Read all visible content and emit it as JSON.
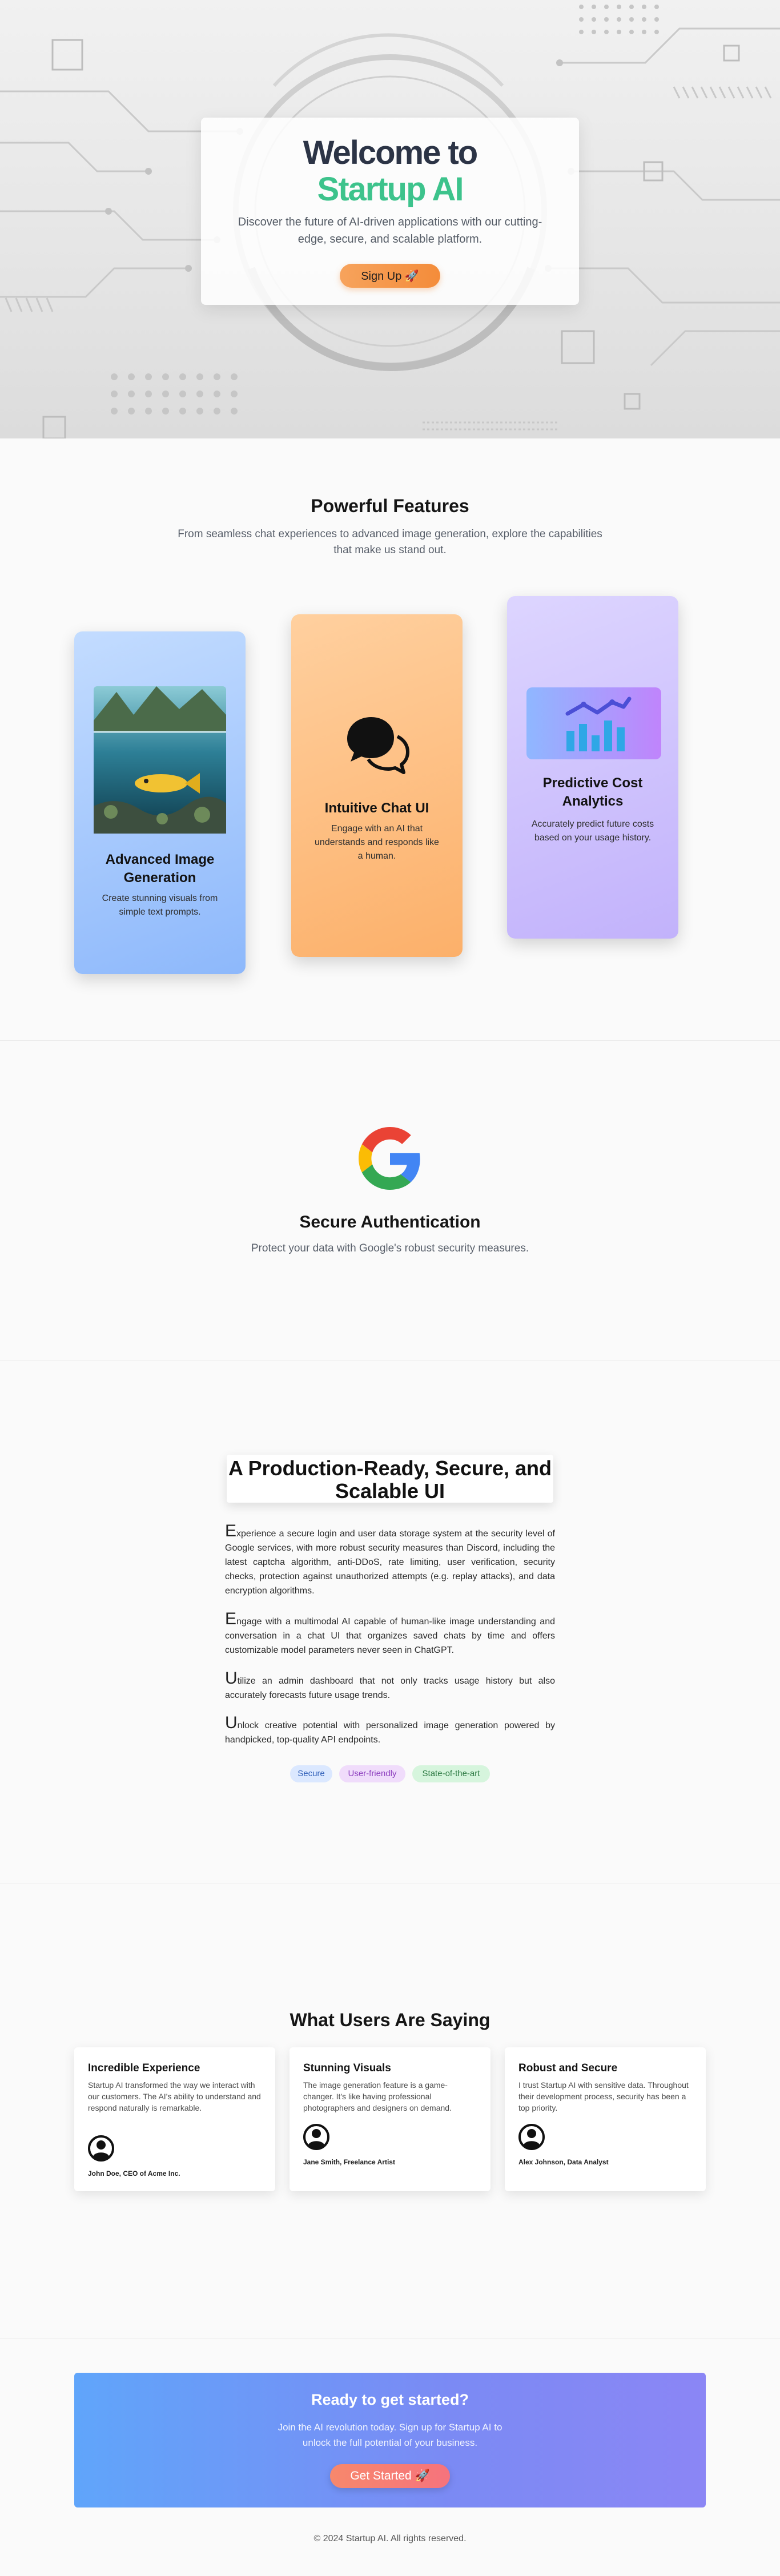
{
  "hero": {
    "title_line1": "Welcome to",
    "title_line2": "Startup AI",
    "subtitle": "Discover the future of AI-driven applications with our cutting-edge, secure, and scalable platform.",
    "cta_label": "Sign Up 🚀"
  },
  "features": {
    "title": "Powerful Features",
    "subtitle": "From seamless chat experiences to advanced image generation, explore the capabilities that make us stand out.",
    "cards": [
      {
        "title": "Advanced Image Generation",
        "desc": "Create stunning visuals from simple text prompts.",
        "icon": "image-icon"
      },
      {
        "title": "Intuitive Chat UI",
        "desc": "Engage with an AI that understands and responds like a human.",
        "icon": "chat-bubbles-icon"
      },
      {
        "title": "Predictive Cost Analytics",
        "desc": "Accurately predict future costs based on your usage history.",
        "icon": "analytics-chart-icon"
      }
    ]
  },
  "auth": {
    "title": "Secure Authentication",
    "subtitle": "Protect your data with Google's robust security measures.",
    "icon": "google-g-icon"
  },
  "production": {
    "title": "A Production-Ready, Secure, and Scalable UI",
    "paragraphs": [
      {
        "cap": "E",
        "text": "xperience a secure login and user data storage system at the security level of Google services, with more robust security measures than Discord, including the latest captcha algorithm, anti-DDoS, rate limiting, user verification, security checks, protection against unauthorized attempts (e.g. replay attacks), and data encryption algorithms."
      },
      {
        "cap": "E",
        "text": "ngage with a multimodal AI capable of human-like image understanding and conversation in a chat UI that organizes saved chats by time and offers customizable model parameters never seen in ChatGPT."
      },
      {
        "cap": "U",
        "text": "tilize an admin dashboard that not only tracks usage history but also accurately forecasts future usage trends."
      },
      {
        "cap": "U",
        "text": "nlock creative potential with personalized image generation powered by handpicked, top-quality API endpoints."
      }
    ],
    "tags": [
      "Secure",
      "User-friendly",
      "State-of-the-art"
    ]
  },
  "testimonials": {
    "title": "What Users Are Saying",
    "items": [
      {
        "title": "Incredible Experience",
        "text": "Startup AI transformed the way we interact with our customers. The AI's ability to understand and respond naturally is remarkable.",
        "author": "John Doe, CEO of Acme Inc."
      },
      {
        "title": "Stunning Visuals",
        "text": "The image generation feature is a game-changer. It's like having professional photographers and designers on demand.",
        "author": "Jane Smith, Freelance Artist"
      },
      {
        "title": "Robust and Secure",
        "text": "I trust Startup AI with sensitive data. Throughout their development process, security has been a top priority.",
        "author": "Alex Johnson, Data Analyst"
      }
    ]
  },
  "cta": {
    "title": "Ready to get started?",
    "subtitle": "Join the AI revolution today. Sign up for Startup AI to unlock the full potential of your business.",
    "button": "Get Started 🚀"
  },
  "footer": {
    "text": "© 2024 Startup AI. All rights reserved."
  },
  "colors": {
    "accent_green": "#3dc38c",
    "accent_orange": "#f48c3a",
    "cta_blue": "#60a5fa",
    "cta_purple": "#8b86f5"
  }
}
